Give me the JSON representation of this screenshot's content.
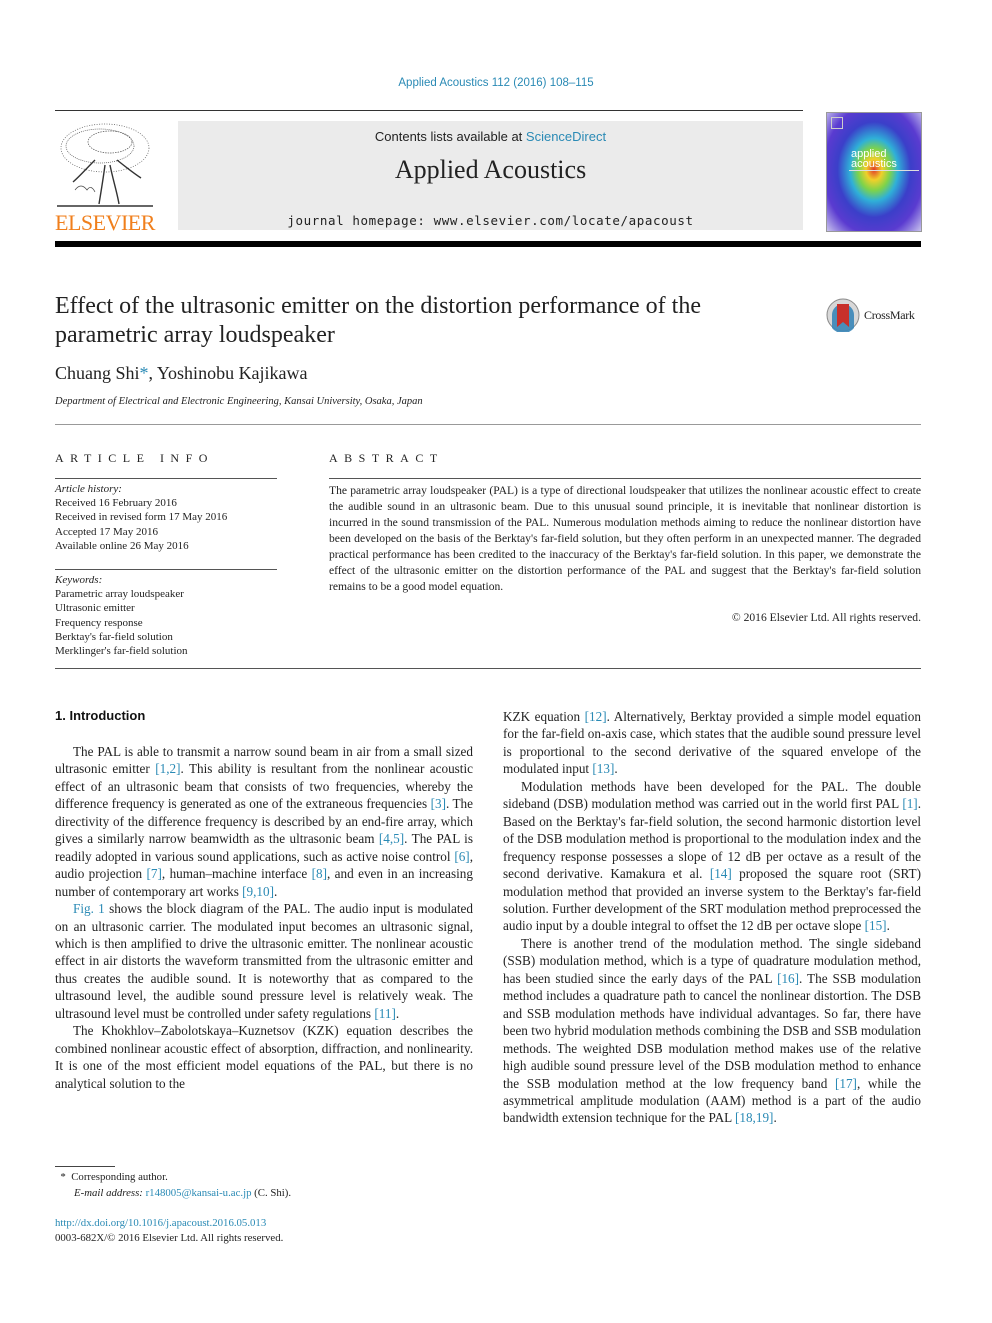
{
  "header": {
    "citation": "Applied Acoustics 112 (2016) 108–115",
    "contents_prefix": "Contents lists available at ",
    "contents_link": "ScienceDirect",
    "journal_name": "Applied Acoustics",
    "homepage": "journal homepage: www.elsevier.com/locate/apacoust",
    "publisher_logo_text": "ELSEVIER",
    "cover_text_line1": "applied",
    "cover_text_line2": "acoustics"
  },
  "article": {
    "title": "Effect of the ultrasonic emitter on the distortion performance of the parametric array loudspeaker",
    "crossmark_label": "CrossMark",
    "authors": [
      {
        "name": "Chuang Shi",
        "marker": "*"
      },
      {
        "name": "Yoshinobu Kajikawa",
        "marker": ""
      }
    ],
    "author_separator": ", ",
    "affiliation": "Department of Electrical and Electronic Engineering, Kansai University, Osaka, Japan"
  },
  "article_info": {
    "heading": "ARTICLE INFO",
    "history_label": "Article history:",
    "history": [
      "Received 16 February 2016",
      "Received in revised form 17 May 2016",
      "Accepted 17 May 2016",
      "Available online 26 May 2016"
    ],
    "keywords_label": "Keywords:",
    "keywords": [
      "Parametric array loudspeaker",
      "Ultrasonic emitter",
      "Frequency response",
      "Berktay's far-field solution",
      "Merklinger's far-field solution"
    ]
  },
  "abstract": {
    "heading": "ABSTRACT",
    "text": "The parametric array loudspeaker (PAL) is a type of directional loudspeaker that utilizes the nonlinear acoustic effect to create the audible sound in an ultrasonic beam. Due to this unusual sound principle, it is inevitable that nonlinear distortion is incurred in the sound transmission of the PAL. Numerous modulation methods aiming to reduce the nonlinear distortion have been developed on the basis of the Berktay's far-field solution, but they often perform in an unexpected manner. The degraded practical performance has been credited to the inaccuracy of the Berktay's far-field solution. In this paper, we demonstrate the effect of the ultrasonic emitter on the distortion performance of the PAL and suggest that the Berktay's far-field solution remains to be a good model equation.",
    "copyright": "© 2016 Elsevier Ltd. All rights reserved."
  },
  "body": {
    "section_heading": "1. Introduction",
    "paragraphs": [
      {
        "column": "left",
        "segments": [
          {
            "t": "The PAL is able to transmit a narrow sound beam in air from a small sized ultrasonic emitter "
          },
          {
            "ref": "[1,2]"
          },
          {
            "t": ". This ability is resultant from the nonlinear acoustic effect of an ultrasonic beam that consists of two frequencies, whereby the difference frequency is generated as one of the extraneous frequencies "
          },
          {
            "ref": "[3]"
          },
          {
            "t": ". The directivity of the difference frequency is described by an end-fire array, which gives a similarly narrow beamwidth as the ultrasonic beam "
          },
          {
            "ref": "[4,5]"
          },
          {
            "t": ". The PAL is readily adopted in various sound applications, such as active noise control "
          },
          {
            "ref": "[6]"
          },
          {
            "t": ", audio projection "
          },
          {
            "ref": "[7]"
          },
          {
            "t": ", human–machine interface "
          },
          {
            "ref": "[8]"
          },
          {
            "t": ", and even in an increasing number of contemporary art works "
          },
          {
            "ref": "[9,10]"
          },
          {
            "t": "."
          }
        ]
      },
      {
        "column": "left",
        "segments": [
          {
            "ref": "Fig. 1"
          },
          {
            "t": " shows the block diagram of the PAL. The audio input is modulated on an ultrasonic carrier. The modulated input becomes an ultrasonic signal, which is then amplified to drive the ultrasonic emitter. The nonlinear acoustic effect in air distorts the waveform transmitted from the ultrasonic emitter and thus creates the audible sound. It is noteworthy that as compared to the ultrasound level, the audible sound pressure level is relatively weak. The ultrasound level must be controlled under safety regulations "
          },
          {
            "ref": "[11]"
          },
          {
            "t": "."
          }
        ]
      },
      {
        "column": "left",
        "segments": [
          {
            "t": "The Khokhlov–Zabolotskaya–Kuznetsov (KZK) equation describes the combined nonlinear acoustic effect of absorption, diffraction, and nonlinearity. It is one of the most efficient model equations of the PAL, but there is no analytical solution to the"
          }
        ]
      },
      {
        "column": "right",
        "continued": true,
        "segments": [
          {
            "t": "KZK equation "
          },
          {
            "ref": "[12]"
          },
          {
            "t": ". Alternatively, Berktay provided a simple model equation for the far-field on-axis case, which states that the audible sound pressure level is proportional to the second derivative of the squared envelope of the modulated input "
          },
          {
            "ref": "[13]"
          },
          {
            "t": "."
          }
        ]
      },
      {
        "column": "right",
        "segments": [
          {
            "t": "Modulation methods have been developed for the PAL. The double sideband (DSB) modulation method was carried out in the world first PAL "
          },
          {
            "ref": "[1]"
          },
          {
            "t": ". Based on the Berktay's far-field solution, the second harmonic distortion level of the DSB modulation method is proportional to the modulation index and the frequency response possesses a slope of 12 dB per octave as a result of the second derivative. Kamakura et al. "
          },
          {
            "ref": "[14]"
          },
          {
            "t": " proposed the square root (SRT) modulation method that provided an inverse system to the Berktay's far-field solution. Further development of the SRT modulation method preprocessed the audio input by a double integral to offset the 12 dB per octave slope "
          },
          {
            "ref": "[15]"
          },
          {
            "t": "."
          }
        ]
      },
      {
        "column": "right",
        "segments": [
          {
            "t": "There is another trend of the modulation method. The single sideband (SSB) modulation method, which is a type of quadrature modulation method, has been studied since the early days of the PAL "
          },
          {
            "ref": "[16]"
          },
          {
            "t": ". The SSB modulation method includes a quadrature path to cancel the nonlinear distortion. The DSB and SSB modulation methods have individual advantages. So far, there have been two hybrid modulation methods combining the DSB and SSB modulation methods. The weighted DSB modulation method makes use of the relative high audible sound pressure level of the DSB modulation method to enhance the SSB modulation method at the low frequency band "
          },
          {
            "ref": "[17]"
          },
          {
            "t": ", while the asymmetrical amplitude modulation (AAM) method is a part of the audio bandwidth extension technique for the PAL "
          },
          {
            "ref": "[18,19]"
          },
          {
            "t": "."
          }
        ]
      }
    ]
  },
  "footnote": {
    "marker": "*",
    "corresponding": "Corresponding author.",
    "email_label": "E-mail address:",
    "email": "r148005@kansai-u.ac.jp",
    "email_suffix": " (C. Shi)."
  },
  "doi": {
    "url": "http://dx.doi.org/10.1016/j.apacoust.2016.05.013",
    "issn_line": "0003-682X/© 2016 Elsevier Ltd. All rights reserved."
  },
  "colors": {
    "link": "#2a8ab5",
    "elsevier_orange": "#f07f1c",
    "masthead_bg": "#ebebeb"
  }
}
